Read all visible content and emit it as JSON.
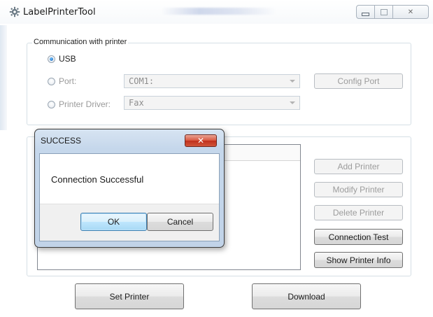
{
  "window": {
    "title": "LabelPrinterTool",
    "controls": {
      "minimize": "▭",
      "maximize": "▢",
      "close": "✕"
    }
  },
  "communication": {
    "group_label": "Communication with printer",
    "usb_label": "USB",
    "usb_selected": true,
    "port_label": "Port:",
    "port_value": "COM1:",
    "driver_label": "Printer Driver:",
    "driver_value": "Fax",
    "config_port_label": "Config Port"
  },
  "printer_buttons": {
    "add": "Add Printer",
    "modify": "Modify Printer",
    "delete": "Delete Printer",
    "test": "Connection Test",
    "info": "Show Printer Info"
  },
  "bottom": {
    "set_printer": "Set Printer",
    "download": "Download"
  },
  "dialog": {
    "title": "SUCCESS",
    "close": "✕",
    "message": "Connection Successful",
    "ok": "OK",
    "cancel": "Cancel"
  },
  "icons": {
    "app": "gear-icon",
    "close": "close-icon",
    "dropdown": "chevron-down-icon"
  },
  "colors": {
    "dialog_frame": "#c5d7eb",
    "close_red": "#c0301c",
    "ok_blue": "#bee6fd",
    "radio_dot": "#1560b5"
  }
}
